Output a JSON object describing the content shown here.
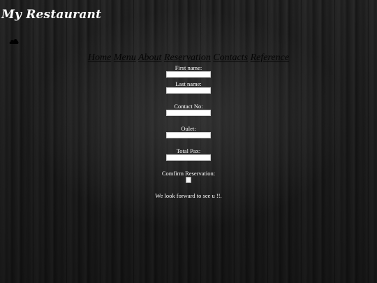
{
  "header": {
    "title": "My Restaurant",
    "logo_icon": "cloud-icon"
  },
  "nav": {
    "items": [
      {
        "label": "Home"
      },
      {
        "label": "Menu"
      },
      {
        "label": "About"
      },
      {
        "label": "Reservation"
      },
      {
        "label": "Contacts"
      },
      {
        "label": "Reference"
      }
    ]
  },
  "form": {
    "first_name_label": "First name:",
    "first_name_value": "",
    "last_name_label": "Last name:",
    "last_name_value": "",
    "contact_label": "Contact No:",
    "contact_value": "",
    "outlet_label": "Oulet:",
    "outlet_value": "",
    "pax_label": "Total Pax:",
    "pax_value": "",
    "confirm_label": "Comfirm Reservation:",
    "confirm_checked": false,
    "note": "We look forward to see u !!."
  }
}
